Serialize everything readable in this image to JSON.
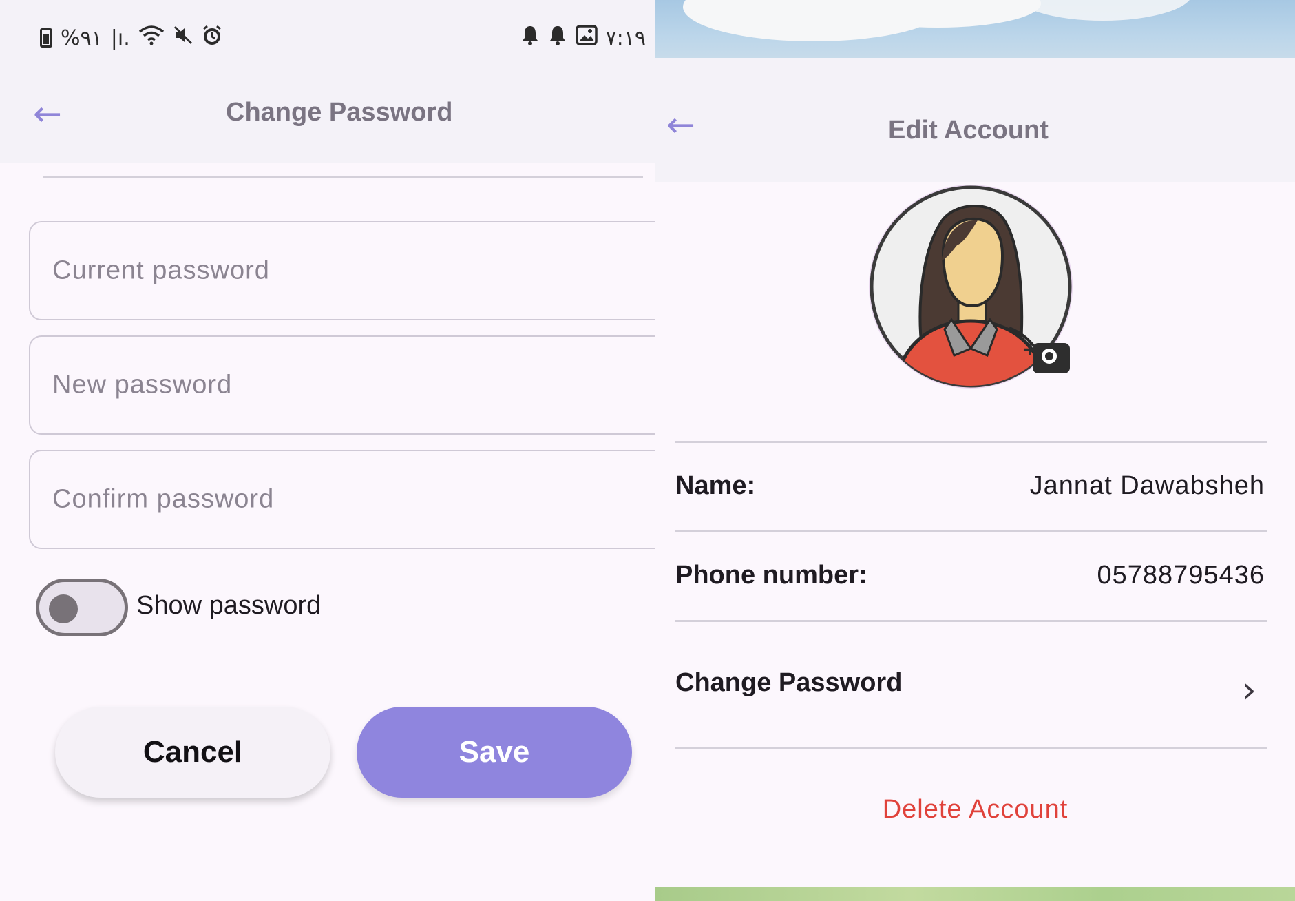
{
  "left_screen": {
    "status_bar": {
      "left_text": "%٩١",
      "signal_text": "|ı.",
      "time": "٧:١٩"
    },
    "app_bar": {
      "title": "Change Password"
    },
    "fields": [
      {
        "placeholder": "Current password",
        "value": ""
      },
      {
        "placeholder": "New password",
        "value": ""
      },
      {
        "placeholder": "Confirm password",
        "value": ""
      }
    ],
    "show_password": {
      "label": "Show password",
      "enabled": false
    },
    "buttons": {
      "cancel": "Cancel",
      "save": "Save"
    }
  },
  "right_screen": {
    "app_bar": {
      "title": "Edit Account"
    },
    "profile": {
      "name_label": "Name:",
      "name_value": "Jannat Dawabsheh",
      "phone_label": "Phone number:",
      "phone_value": "05788795436"
    },
    "change_password_label": "Change Password",
    "delete_label": "Delete Account"
  },
  "colors": {
    "accent": "#8f85de",
    "background": "#fcf7fd",
    "appbar": "#f4f2f8",
    "danger": "#e0423b",
    "title_text": "#7a7482"
  }
}
